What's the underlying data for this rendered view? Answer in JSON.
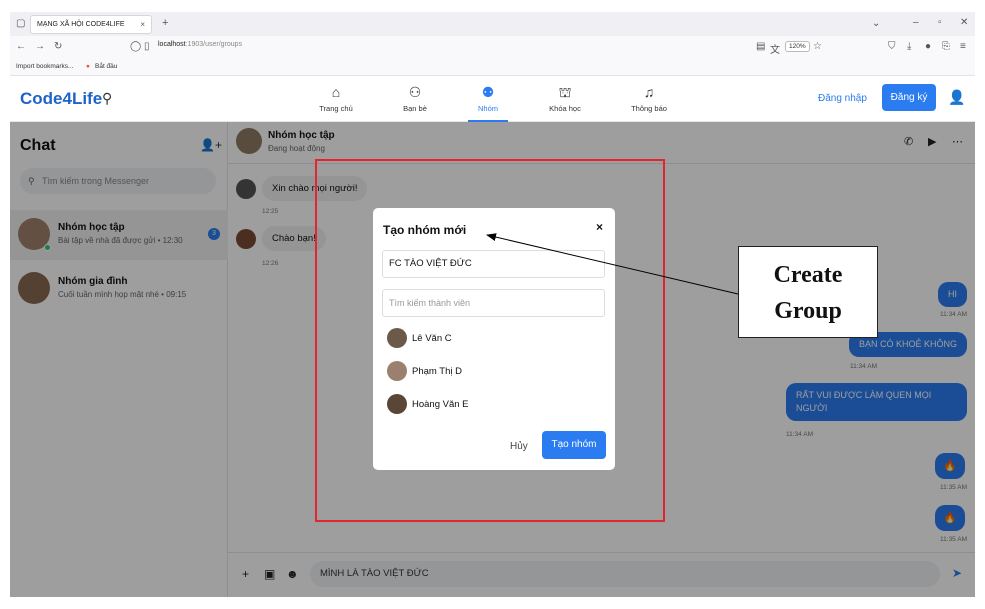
{
  "browser": {
    "tab_title": "MẠNG XÃ HỘI CODE4LIFE",
    "tab_close": "×",
    "new_tab": "+",
    "url_host": "localhost",
    "url_path": ":1903/user/groups",
    "zoom": "120%",
    "bookmarks": [
      "Import bookmarks...",
      "Bắt đầu"
    ]
  },
  "header": {
    "logo": "Code4Life",
    "nav": [
      {
        "label": "Trang chủ",
        "icon": "home-icon",
        "glyph": "⌂"
      },
      {
        "label": "Bạn bè",
        "icon": "friends-icon",
        "glyph": "👥"
      },
      {
        "label": "Nhóm",
        "icon": "groups-icon",
        "glyph": "👥"
      },
      {
        "label": "Khóa học",
        "icon": "graduation-cap-icon",
        "glyph": "🎓"
      },
      {
        "label": "Thông báo",
        "icon": "bell-icon",
        "glyph": "🔔"
      }
    ],
    "login": "Đăng nhập",
    "signup": "Đăng ký"
  },
  "sidebar": {
    "title": "Chat",
    "search_placeholder": "Tìm kiếm trong Messenger",
    "conversations": [
      {
        "name": "Nhóm học tập",
        "last": "Bài tập về nhà đã được gửi • 12:30",
        "badge": "3"
      },
      {
        "name": "Nhóm gia đình",
        "last": "Cuối tuần mình họp mặt nhé • 09:15"
      }
    ]
  },
  "chat": {
    "name": "Nhóm học tập",
    "status": "Đang hoạt động",
    "incoming": [
      {
        "text": "Xin chào mọi người!",
        "time": "12:25"
      },
      {
        "text": "Chào bạn!",
        "time": "12:26"
      }
    ],
    "outgoing": [
      {
        "text": "HI",
        "time": "11:34 AM"
      },
      {
        "text": "BẠN CÓ KHOẺ KHÔNG",
        "time": "11:34 AM"
      },
      {
        "text": "RẤT VUI ĐƯỢC LÀM QUEN MỌI NGƯỜI",
        "time": "11:34 AM"
      },
      {
        "text": "",
        "time": "11:35 AM"
      },
      {
        "text": "",
        "time": "11:35 AM"
      }
    ],
    "composer_value": "MÌNH LÀ TÀO VIỆT ĐỨC"
  },
  "modal": {
    "title": "Tạo nhóm mới",
    "close": "×",
    "group_name_value": "FC TÀO VIỆT ĐỨC",
    "search_placeholder": "Tìm kiếm thành viên",
    "members": [
      "Lê Văn C",
      "Phạm Thị D",
      "Hoàng Văn E"
    ],
    "cancel": "Hủy",
    "create": "Tạo nhóm"
  },
  "annotation": {
    "callout_line1": "Create",
    "callout_line2": "Group",
    "color": "#e3262e"
  }
}
